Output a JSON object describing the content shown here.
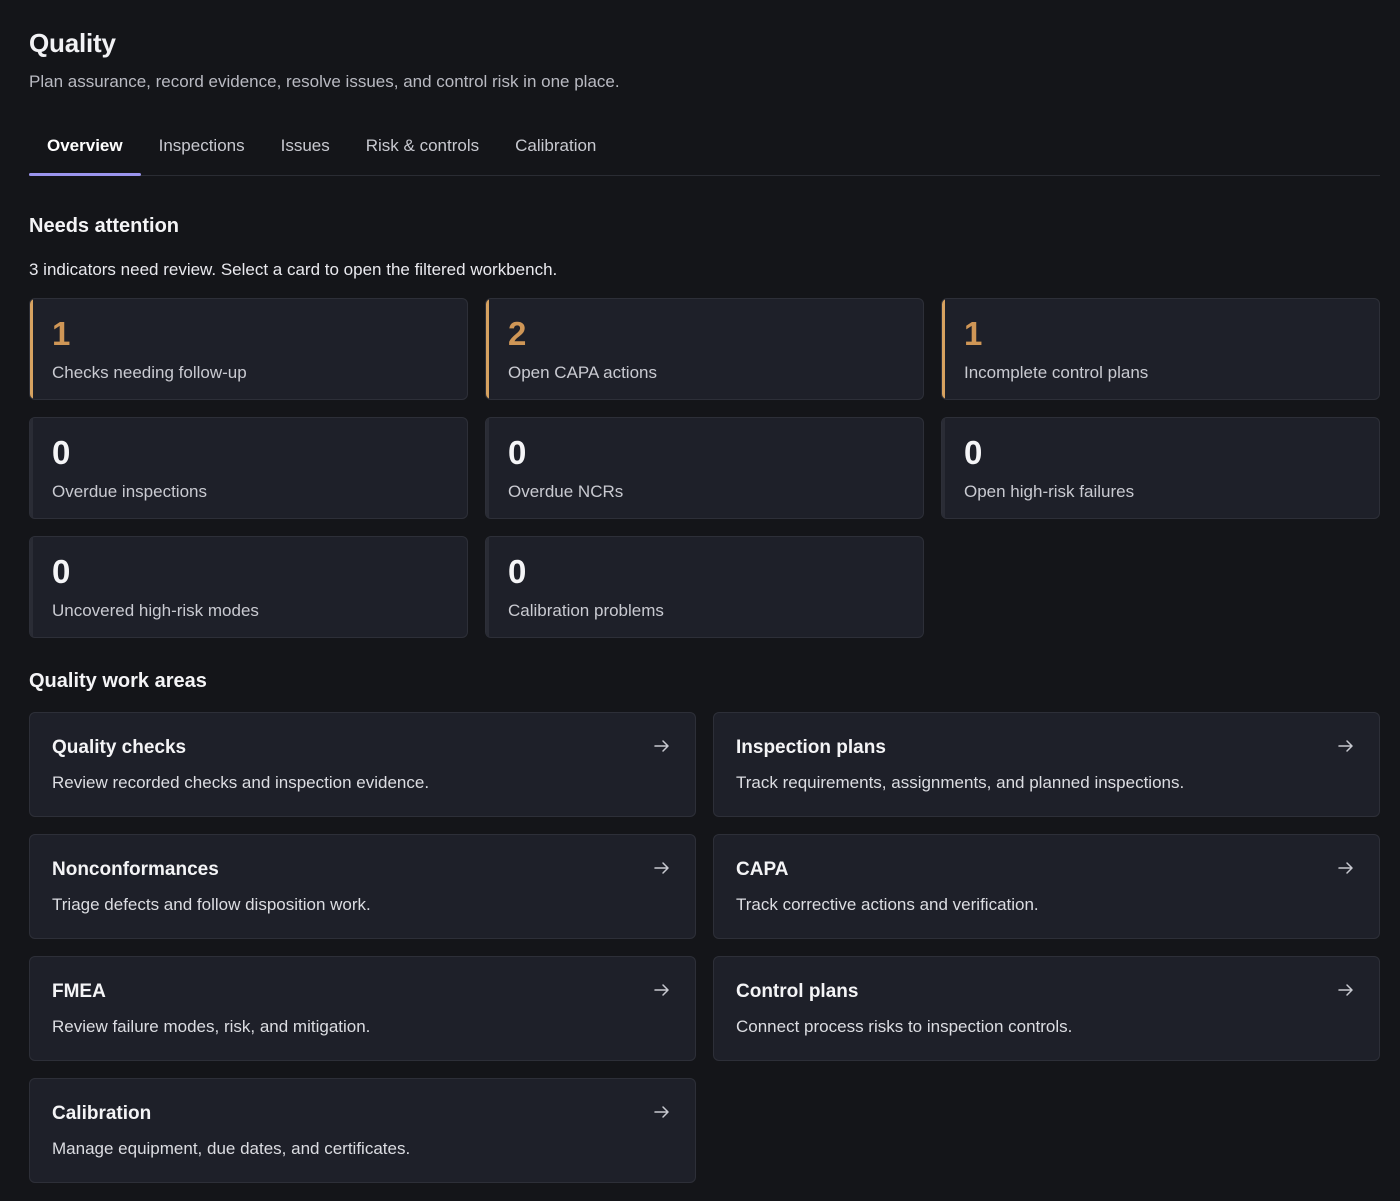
{
  "header": {
    "title": "Quality",
    "subtitle": "Plan assurance, record evidence, resolve issues, and control risk in one place."
  },
  "tabs": [
    {
      "label": "Overview",
      "active": true
    },
    {
      "label": "Inspections",
      "active": false
    },
    {
      "label": "Issues",
      "active": false
    },
    {
      "label": "Risk & controls",
      "active": false
    },
    {
      "label": "Calibration",
      "active": false
    }
  ],
  "attention": {
    "title": "Needs attention",
    "description": "3 indicators need review. Select a card to open the filtered workbench.",
    "cards": [
      {
        "value": "1",
        "label": "Checks needing follow-up",
        "warn": true
      },
      {
        "value": "2",
        "label": "Open CAPA actions",
        "warn": true
      },
      {
        "value": "1",
        "label": "Incomplete control plans",
        "warn": true
      },
      {
        "value": "0",
        "label": "Overdue inspections",
        "warn": false
      },
      {
        "value": "0",
        "label": "Overdue NCRs",
        "warn": false
      },
      {
        "value": "0",
        "label": "Open high-risk failures",
        "warn": false
      },
      {
        "value": "0",
        "label": "Uncovered high-risk modes",
        "warn": false
      },
      {
        "value": "0",
        "label": "Calibration problems",
        "warn": false
      }
    ]
  },
  "work_areas": {
    "title": "Quality work areas",
    "cards": [
      {
        "title": "Quality checks",
        "description": "Review recorded checks and inspection evidence.",
        "icon": "arrow-right-icon"
      },
      {
        "title": "Inspection plans",
        "description": "Track requirements, assignments, and planned inspections.",
        "icon": "arrow-right-icon"
      },
      {
        "title": "Nonconformances",
        "description": "Triage defects and follow disposition work.",
        "icon": "arrow-right-icon"
      },
      {
        "title": "CAPA",
        "description": "Track corrective actions and verification.",
        "icon": "arrow-right-icon"
      },
      {
        "title": "FMEA",
        "description": "Review failure modes, risk, and mitigation.",
        "icon": "arrow-right-icon"
      },
      {
        "title": "Control plans",
        "description": "Connect process risks to inspection controls.",
        "icon": "arrow-right-icon"
      },
      {
        "title": "Calibration",
        "description": "Manage equipment, due dates, and certificates.",
        "icon": "arrow-right-icon"
      }
    ]
  },
  "colors": {
    "background": "#141519",
    "card": "#1e2029",
    "warn_accent": "#cf9656",
    "tab_indicator": "#9b95ee"
  }
}
